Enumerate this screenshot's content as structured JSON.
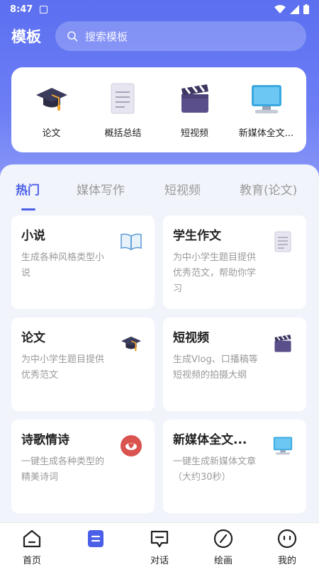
{
  "status": {
    "time": "8:47"
  },
  "header": {
    "title": "模板",
    "search_placeholder": "搜索模板"
  },
  "quick_items": [
    {
      "label": "论文",
      "icon": "graduation-cap-icon"
    },
    {
      "label": "概括总结",
      "icon": "document-icon"
    },
    {
      "label": "短视频",
      "icon": "clapperboard-icon"
    },
    {
      "label": "新媒体全文...",
      "icon": "monitor-icon"
    }
  ],
  "tabs": [
    {
      "label": "热门"
    },
    {
      "label": "媒体写作"
    },
    {
      "label": "短视频"
    },
    {
      "label": "教育(论文)"
    }
  ],
  "cards": [
    {
      "title": "小说",
      "desc": "生成各种风格类型小说",
      "icon": "open-book-icon"
    },
    {
      "title": "学生作文",
      "desc": "为中小学生题目提供优秀范文，帮助你学习",
      "icon": "document-icon"
    },
    {
      "title": "论文",
      "desc": "为中小学生题目提供优秀范文",
      "icon": "graduation-cap-icon"
    },
    {
      "title": "短视频",
      "desc": "生成Vlog、口播稿等短视频的拍摄大纲",
      "icon": "clapperboard-icon"
    },
    {
      "title": "诗歌情诗",
      "desc": "一键生成各种类型的精美诗词",
      "icon": "heart-badge-icon"
    },
    {
      "title": "新媒体全文...",
      "desc": "一键生成新媒体文章（大约30秒）",
      "icon": "monitor-icon"
    }
  ],
  "nav": [
    {
      "label": "首页",
      "icon": "home-icon"
    },
    {
      "label": "",
      "icon": "template-icon"
    },
    {
      "label": "对话",
      "icon": "chat-icon"
    },
    {
      "label": "绘画",
      "icon": "compass-icon"
    },
    {
      "label": "我的",
      "icon": "profile-icon"
    }
  ],
  "colors": {
    "accent": "#4a5fe8",
    "hero": "#5b6ff0"
  }
}
